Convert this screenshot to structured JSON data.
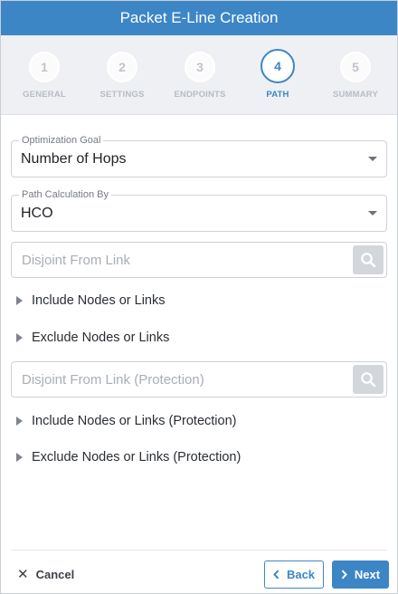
{
  "dialog": {
    "title": "Packet E-Line Creation"
  },
  "stepper": {
    "steps": [
      {
        "number": "1",
        "label": "GENERAL"
      },
      {
        "number": "2",
        "label": "SETTINGS"
      },
      {
        "number": "3",
        "label": "ENDPOINTS"
      },
      {
        "number": "4",
        "label": "PATH"
      },
      {
        "number": "5",
        "label": "SUMMARY"
      }
    ],
    "active_step": "4"
  },
  "form": {
    "optimization_goal": {
      "label": "Optimization Goal",
      "value": "Number of Hops"
    },
    "path_calculation_by": {
      "label": "Path Calculation By",
      "value": "HCO"
    },
    "disjoint_from_link": {
      "placeholder": "Disjoint From Link"
    },
    "include_nodes": {
      "label": "Include Nodes or Links"
    },
    "exclude_nodes": {
      "label": "Exclude Nodes or Links"
    },
    "disjoint_from_link_protection": {
      "placeholder": "Disjoint From Link (Protection)"
    },
    "include_nodes_protection": {
      "label": "Include Nodes or Links (Protection)"
    },
    "exclude_nodes_protection": {
      "label": "Exclude Nodes or Links (Protection)"
    }
  },
  "footer": {
    "cancel_label": "Cancel",
    "back_label": "Back",
    "next_label": "Next"
  },
  "colors": {
    "accent": "#3d86c6",
    "stepper_bg": "#eef0f3",
    "search_button": "#d3d7dc"
  },
  "icons": {
    "search": "search-icon",
    "dropdown": "chevron-down-icon",
    "expand": "caret-right-icon",
    "close": "close-icon",
    "back": "chevron-left-icon",
    "next": "chevron-right-icon"
  }
}
